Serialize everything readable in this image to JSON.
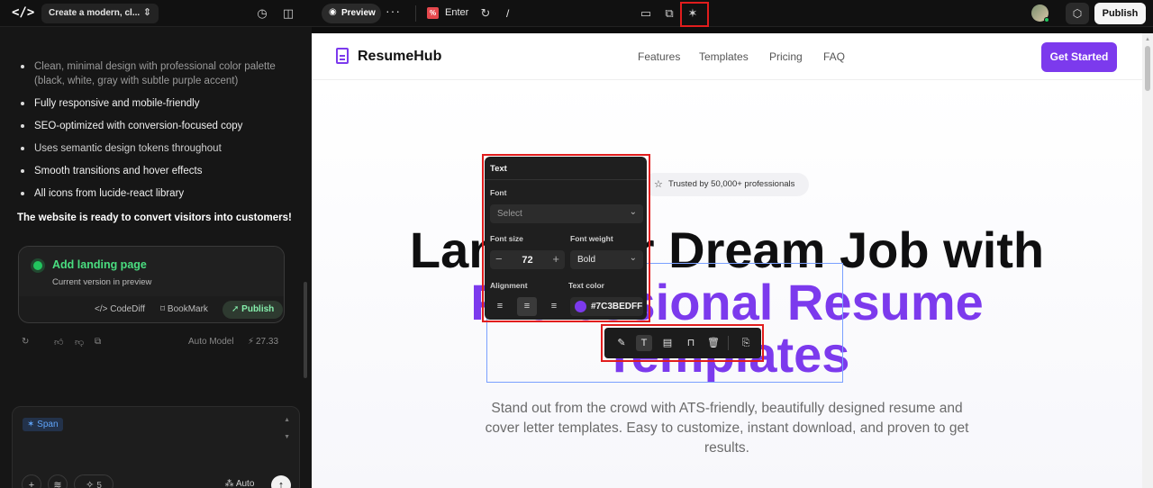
{
  "topbar": {
    "logo": "</>",
    "project_title": "Create a modern, cl...",
    "preview_label": "Preview",
    "route_name": "Enter",
    "route_path": "/",
    "publish_label": "Publish"
  },
  "chat": {
    "bullets": [
      "Clean, minimal design with professional color palette (black, white, gray with subtle purple accent)",
      "Fully responsive and mobile-friendly",
      "SEO-optimized with conversion-focused copy",
      "Uses semantic design tokens throughout",
      "Smooth transitions and hover effects",
      "All icons from lucide-react library"
    ],
    "ready_text": "The website is ready to convert visitors into customers!",
    "version_card": {
      "title": "Add landing page",
      "subtitle": "Current version in preview",
      "codediff_label": "CodeDiff",
      "bookmark_label": "BookMark",
      "publish_label": "Publish"
    },
    "model_label": "Auto Model",
    "credits": "27.33"
  },
  "composer": {
    "chip_label": "Span",
    "count": "5",
    "auto_label": "Auto"
  },
  "site": {
    "brand": "ResumeHub",
    "nav": [
      "Features",
      "Templates",
      "Pricing",
      "FAQ"
    ],
    "cta": "Get Started",
    "trusted": "Trusted by 50,000+ professionals",
    "headline_1": "Land Your Dream Job with",
    "headline_2": "Professional Resume",
    "headline_3": "Templates",
    "subtitle": "Stand out from the crowd with ATS-friendly, beautifully designed resume and cover letter templates. Easy to customize, instant download, and proven to get results."
  },
  "text_panel": {
    "header": "Text",
    "font_label": "Font",
    "font_placeholder": "Select",
    "size_label": "Font size",
    "size_value": "72",
    "weight_label": "Font weight",
    "weight_value": "Bold",
    "alignment_label": "Alignment",
    "color_label": "Text color",
    "color_hex": "#7C3BEDFF"
  },
  "colors": {
    "accent": "#7c3aed",
    "highlight": "#e11d1d",
    "success": "#22c55e"
  }
}
